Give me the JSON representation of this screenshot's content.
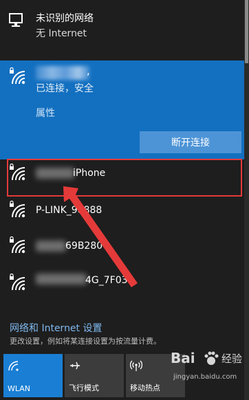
{
  "network_status": {
    "title": "未识别的网络",
    "subtitle": "无 Internet"
  },
  "connected_network": {
    "ssid_suffix": ",",
    "status": "已连接，安全",
    "properties_link": "属性",
    "disconnect_button": "断开连接"
  },
  "networks": [
    {
      "name_visible": "iPhone"
    },
    {
      "name_visible": "P-LINK_98888"
    },
    {
      "name_visible": "69B280"
    },
    {
      "name_visible": "4G_7F03"
    }
  ],
  "footer": {
    "settings_link": "网络和 Internet 设置",
    "settings_desc": "更改设置，例如将某连接设置为按流量计费。"
  },
  "quick_actions": [
    {
      "label": "WLAN",
      "icon": "wifi-icon",
      "active": true
    },
    {
      "label": "飞行模式",
      "icon": "airplane-icon",
      "active": false
    },
    {
      "label": "移动热点",
      "icon": "hotspot-icon",
      "active": false
    }
  ],
  "watermark": {
    "brand": "Bai",
    "brand_suffix": "经验",
    "url": "jingyan.baidu.com"
  },
  "colors": {
    "accent": "#1370c0",
    "annotation": "#e53a3a",
    "link": "#7fb8ee"
  }
}
